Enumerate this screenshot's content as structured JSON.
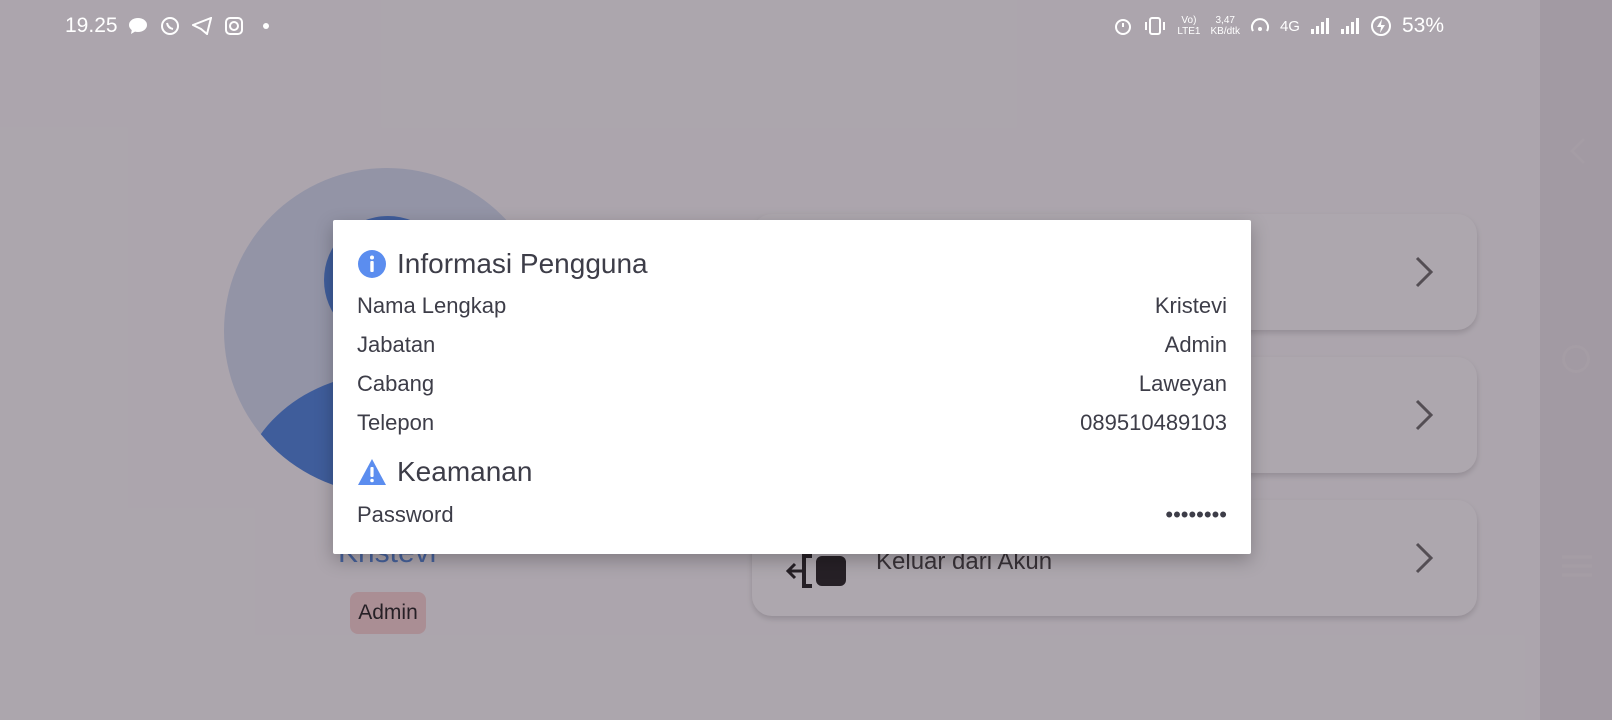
{
  "status_bar": {
    "time": "19.25",
    "net_speed_value": "3,47",
    "net_speed_unit": "KB/dtk",
    "volte_label": "Vo)",
    "lte_label": "LTE1",
    "network_type": "4G",
    "battery": "53%"
  },
  "profile": {
    "name": "Kristevi",
    "role": "Admin"
  },
  "menu": {
    "items": [
      {
        "label": ""
      },
      {
        "label": ""
      },
      {
        "label": "Keluar dari Akun"
      }
    ]
  },
  "dialog": {
    "user_info_title": "Informasi Pengguna",
    "rows": [
      {
        "label": "Nama Lengkap",
        "value": "Kristevi"
      },
      {
        "label": "Jabatan",
        "value": "Admin"
      },
      {
        "label": "Cabang",
        "value": "Laweyan"
      },
      {
        "label": "Telepon",
        "value": "089510489103"
      }
    ],
    "security_title": "Keamanan",
    "password_label": "Password",
    "password_value": "••••••••"
  },
  "colors": {
    "accent": "#3c78d8",
    "info_icon": "#5b8def",
    "badge": "#f0c9c9"
  }
}
